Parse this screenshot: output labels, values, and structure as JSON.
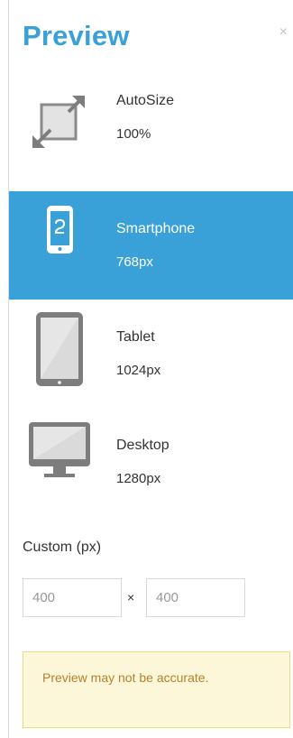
{
  "header": {
    "title": "Preview",
    "close_symbol": "×"
  },
  "devices": [
    {
      "name": "AutoSize",
      "size": "100%",
      "icon": "autosize-icon",
      "active": false
    },
    {
      "name": "Smartphone",
      "size": "768px",
      "icon": "smartphone-icon",
      "active": true
    },
    {
      "name": "Tablet",
      "size": "1024px",
      "icon": "tablet-icon",
      "active": false
    },
    {
      "name": "Desktop",
      "size": "1280px",
      "icon": "desktop-icon",
      "active": false
    }
  ],
  "custom": {
    "label": "Custom (px)",
    "width_value": "400",
    "height_value": "400",
    "separator": "×"
  },
  "warning": {
    "text": "Preview may not be accurate."
  },
  "colors": {
    "accent": "#3aa0d8",
    "icon_gray": "#7d7d7d",
    "warning_bg": "#fdf7d9",
    "warning_text": "#b6802f"
  }
}
